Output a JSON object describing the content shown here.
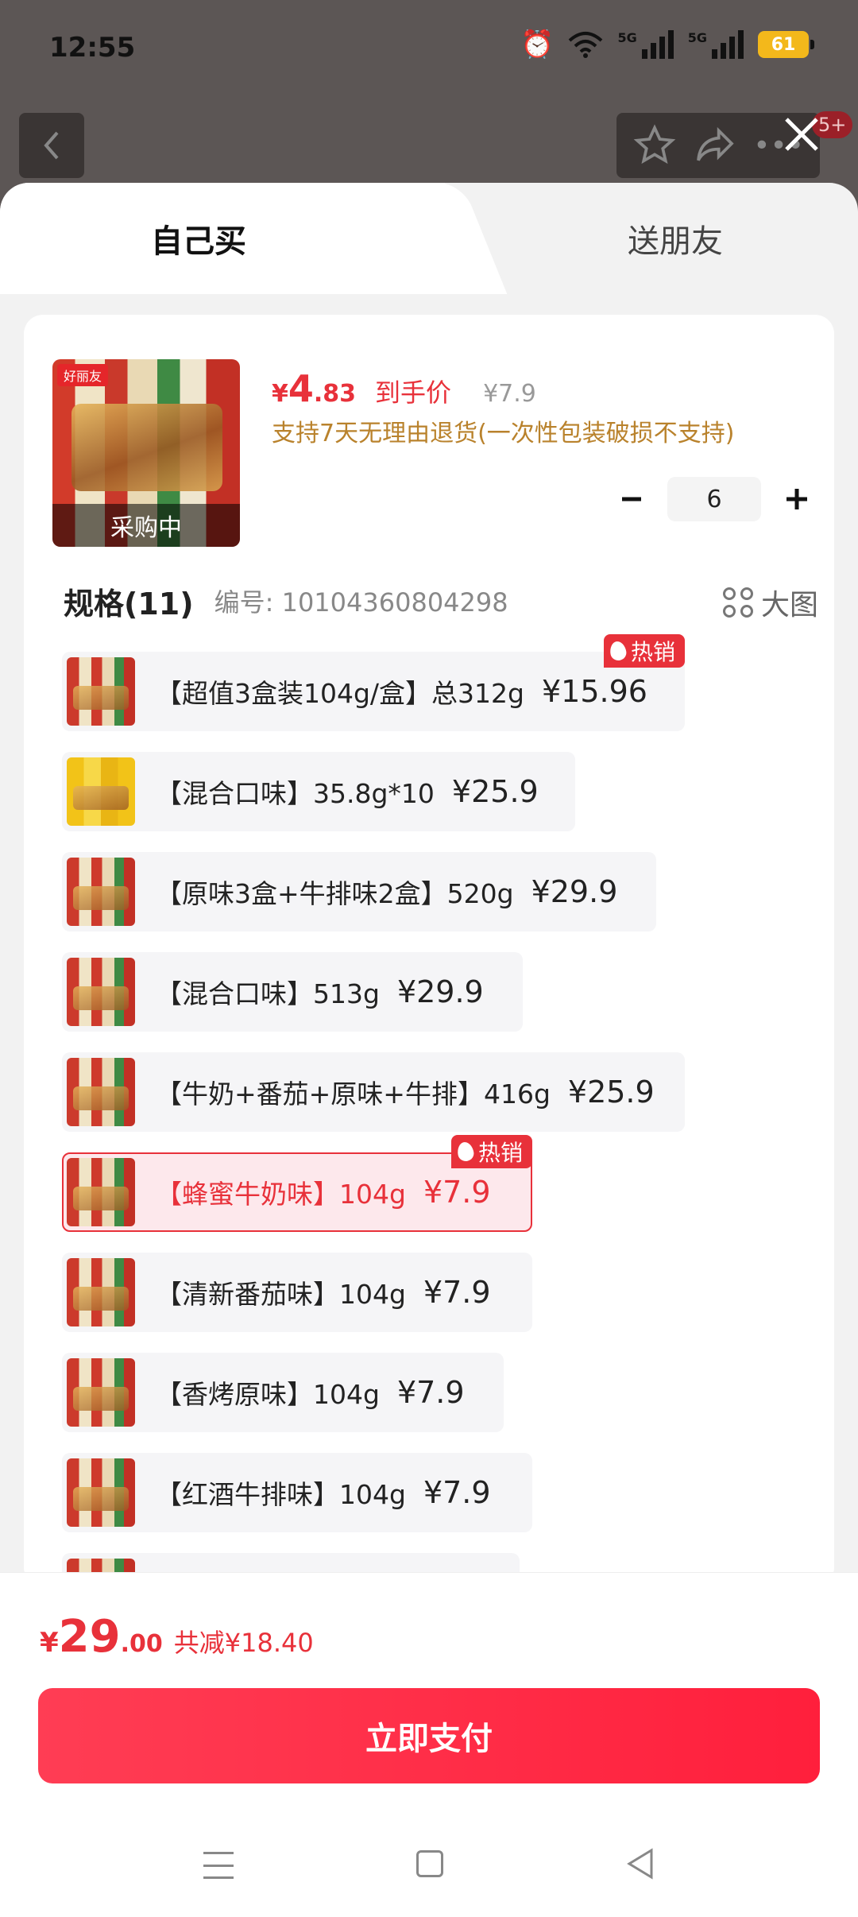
{
  "status_bar": {
    "time": "12:55",
    "battery": "61",
    "network1": "5G",
    "network2": "5G"
  },
  "background": {
    "notification_count": "5+"
  },
  "tabs": {
    "self_buy": "自己买",
    "gift_friend": "送朋友"
  },
  "product": {
    "buying_label": "采购中",
    "brand_logo": "好丽友",
    "price_symbol": "¥",
    "price_int": "4",
    "price_dec": ".83",
    "price_tag": "到手价",
    "original_price": "¥7.9",
    "return_policy": "支持7天无理由退货(一次性包装破损不支持)",
    "quantity": "6"
  },
  "spec": {
    "title": "规格(11)",
    "code": "编号: 10104360804298",
    "big_image": "大图",
    "hot_label": "热销",
    "items": [
      {
        "text": "【超值3盒装104g/盒】总312g",
        "price": "¥15.96",
        "hot": true,
        "selected": false
      },
      {
        "text": "【混合口味】35.8g*10",
        "price": "¥25.9",
        "hot": false,
        "selected": false
      },
      {
        "text": "【原味3盒+牛排味2盒】520g",
        "price": "¥29.9",
        "hot": false,
        "selected": false
      },
      {
        "text": "【混合口味】513g",
        "price": "¥29.9",
        "hot": false,
        "selected": false
      },
      {
        "text": "【牛奶+番茄+原味+牛排】416g",
        "price": "¥25.9",
        "hot": false,
        "selected": false
      },
      {
        "text": "【蜂蜜牛奶味】104g",
        "price": "¥7.9",
        "hot": true,
        "selected": true
      },
      {
        "text": "【清新番茄味】104g",
        "price": "¥7.9",
        "hot": false,
        "selected": false
      },
      {
        "text": "【香烤原味】104g",
        "price": "¥7.9",
        "hot": false,
        "selected": false
      },
      {
        "text": "【红酒牛排味】104g",
        "price": "¥7.9",
        "hot": false,
        "selected": false
      }
    ]
  },
  "total": {
    "symbol": "¥",
    "int": "29",
    "dec": ".00",
    "saving": "共减¥18.40"
  },
  "pay_button": "立即支付",
  "colors": {
    "accent": "#e8313a",
    "policy": "#b9822c",
    "pay_gradient_start": "#ff3d54",
    "pay_gradient_end": "#ff1f3c"
  }
}
